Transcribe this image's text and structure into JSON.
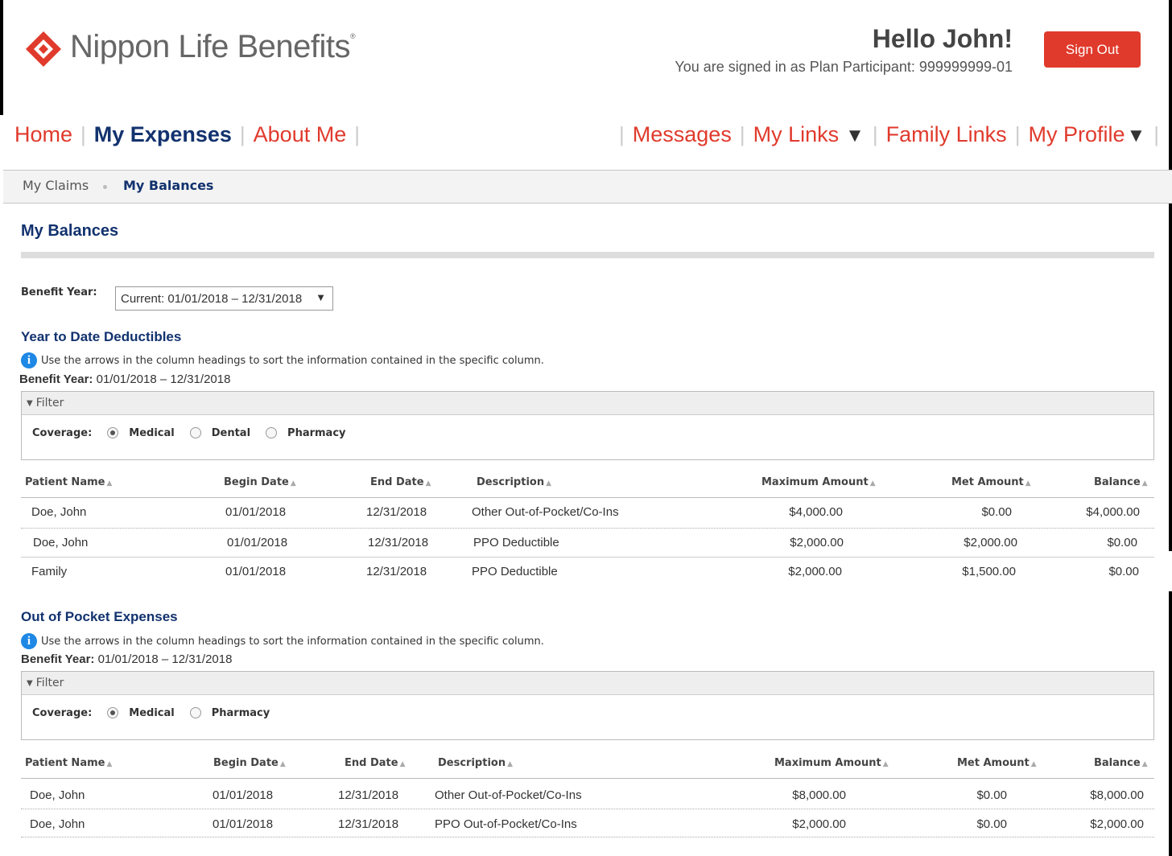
{
  "header": {
    "brand": "Nippon Life Benefits",
    "greeting": "Hello John!",
    "signed_in": "You are signed in as Plan Participant: 999999999-01",
    "sign_out": "Sign Out"
  },
  "nav": {
    "left": [
      "Home",
      "My Expenses",
      "About Me"
    ],
    "right": [
      "Messages",
      "My Links",
      "Family Links",
      "My Profile"
    ]
  },
  "subnav": {
    "claims": "My Claims",
    "balances": "My Balances"
  },
  "page": {
    "title": "My Balances",
    "benefit_year_label": "Benefit Year:",
    "benefit_year_value": "Current: 01/01/2018 – 12/31/2018"
  },
  "columns": [
    "Patient Name",
    "Begin Date",
    "End Date",
    "Description",
    "Maximum Amount",
    "Met Amount",
    "Balance"
  ],
  "ytd": {
    "title": "Year to Date Deductibles",
    "info": "Use the arrows in the column headings to sort the information contained in the specific column.",
    "by_label": "Benefit Year:",
    "by_value": "01/01/2018 – 12/31/2018",
    "filter": "Filter",
    "coverage_label": "Coverage:",
    "coverage": [
      "Medical",
      "Dental",
      "Pharmacy"
    ],
    "rows": [
      [
        "Doe, John",
        "01/01/2018",
        "12/31/2018",
        "Other Out-of-Pocket/Co-Ins",
        "$4,000.00",
        "$0.00",
        "$4,000.00"
      ],
      [
        "Doe, John",
        "01/01/2018",
        "12/31/2018",
        "PPO Deductible",
        "$2,000.00",
        "$2,000.00",
        "$0.00"
      ],
      [
        "Family",
        "01/01/2018",
        "12/31/2018",
        "PPO Deductible",
        "$2,000.00",
        "$1,500.00",
        "$0.00"
      ]
    ]
  },
  "oop": {
    "title": "Out of Pocket Expenses",
    "info": "Use the arrows in the column headings to sort the information contained in the specific column.",
    "by_label": "Benefit Year:",
    "by_value": "01/01/2018 – 12/31/2018",
    "filter": "Filter",
    "coverage_label": "Coverage:",
    "coverage": [
      "Medical",
      "Pharmacy"
    ],
    "rows": [
      [
        "Doe, John",
        "01/01/2018",
        "12/31/2018",
        "Other Out-of-Pocket/Co-Ins",
        "$8,000.00",
        "$0.00",
        "$8,000.00"
      ],
      [
        "Doe, John",
        "01/01/2018",
        "12/31/2018",
        "PPO Out-of-Pocket/Co-Ins",
        "$2,000.00",
        "$0.00",
        "$2,000.00"
      ]
    ]
  },
  "colors": {
    "accent_red": "#e03a2c",
    "navy": "#12326e"
  }
}
